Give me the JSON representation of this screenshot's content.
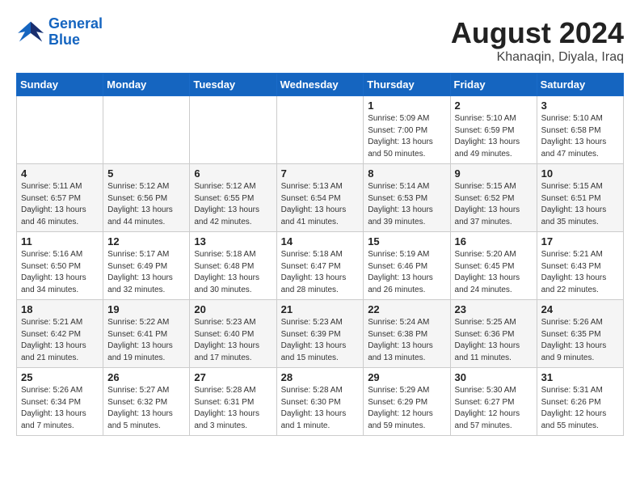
{
  "logo": {
    "line1": "General",
    "line2": "Blue"
  },
  "title": "August 2024",
  "subtitle": "Khanaqin, Diyala, Iraq",
  "headers": [
    "Sunday",
    "Monday",
    "Tuesday",
    "Wednesday",
    "Thursday",
    "Friday",
    "Saturday"
  ],
  "weeks": [
    [
      {
        "day": "",
        "info": ""
      },
      {
        "day": "",
        "info": ""
      },
      {
        "day": "",
        "info": ""
      },
      {
        "day": "",
        "info": ""
      },
      {
        "day": "1",
        "info": "Sunrise: 5:09 AM\nSunset: 7:00 PM\nDaylight: 13 hours\nand 50 minutes."
      },
      {
        "day": "2",
        "info": "Sunrise: 5:10 AM\nSunset: 6:59 PM\nDaylight: 13 hours\nand 49 minutes."
      },
      {
        "day": "3",
        "info": "Sunrise: 5:10 AM\nSunset: 6:58 PM\nDaylight: 13 hours\nand 47 minutes."
      }
    ],
    [
      {
        "day": "4",
        "info": "Sunrise: 5:11 AM\nSunset: 6:57 PM\nDaylight: 13 hours\nand 46 minutes."
      },
      {
        "day": "5",
        "info": "Sunrise: 5:12 AM\nSunset: 6:56 PM\nDaylight: 13 hours\nand 44 minutes."
      },
      {
        "day": "6",
        "info": "Sunrise: 5:12 AM\nSunset: 6:55 PM\nDaylight: 13 hours\nand 42 minutes."
      },
      {
        "day": "7",
        "info": "Sunrise: 5:13 AM\nSunset: 6:54 PM\nDaylight: 13 hours\nand 41 minutes."
      },
      {
        "day": "8",
        "info": "Sunrise: 5:14 AM\nSunset: 6:53 PM\nDaylight: 13 hours\nand 39 minutes."
      },
      {
        "day": "9",
        "info": "Sunrise: 5:15 AM\nSunset: 6:52 PM\nDaylight: 13 hours\nand 37 minutes."
      },
      {
        "day": "10",
        "info": "Sunrise: 5:15 AM\nSunset: 6:51 PM\nDaylight: 13 hours\nand 35 minutes."
      }
    ],
    [
      {
        "day": "11",
        "info": "Sunrise: 5:16 AM\nSunset: 6:50 PM\nDaylight: 13 hours\nand 34 minutes."
      },
      {
        "day": "12",
        "info": "Sunrise: 5:17 AM\nSunset: 6:49 PM\nDaylight: 13 hours\nand 32 minutes."
      },
      {
        "day": "13",
        "info": "Sunrise: 5:18 AM\nSunset: 6:48 PM\nDaylight: 13 hours\nand 30 minutes."
      },
      {
        "day": "14",
        "info": "Sunrise: 5:18 AM\nSunset: 6:47 PM\nDaylight: 13 hours\nand 28 minutes."
      },
      {
        "day": "15",
        "info": "Sunrise: 5:19 AM\nSunset: 6:46 PM\nDaylight: 13 hours\nand 26 minutes."
      },
      {
        "day": "16",
        "info": "Sunrise: 5:20 AM\nSunset: 6:45 PM\nDaylight: 13 hours\nand 24 minutes."
      },
      {
        "day": "17",
        "info": "Sunrise: 5:21 AM\nSunset: 6:43 PM\nDaylight: 13 hours\nand 22 minutes."
      }
    ],
    [
      {
        "day": "18",
        "info": "Sunrise: 5:21 AM\nSunset: 6:42 PM\nDaylight: 13 hours\nand 21 minutes."
      },
      {
        "day": "19",
        "info": "Sunrise: 5:22 AM\nSunset: 6:41 PM\nDaylight: 13 hours\nand 19 minutes."
      },
      {
        "day": "20",
        "info": "Sunrise: 5:23 AM\nSunset: 6:40 PM\nDaylight: 13 hours\nand 17 minutes."
      },
      {
        "day": "21",
        "info": "Sunrise: 5:23 AM\nSunset: 6:39 PM\nDaylight: 13 hours\nand 15 minutes."
      },
      {
        "day": "22",
        "info": "Sunrise: 5:24 AM\nSunset: 6:38 PM\nDaylight: 13 hours\nand 13 minutes."
      },
      {
        "day": "23",
        "info": "Sunrise: 5:25 AM\nSunset: 6:36 PM\nDaylight: 13 hours\nand 11 minutes."
      },
      {
        "day": "24",
        "info": "Sunrise: 5:26 AM\nSunset: 6:35 PM\nDaylight: 13 hours\nand 9 minutes."
      }
    ],
    [
      {
        "day": "25",
        "info": "Sunrise: 5:26 AM\nSunset: 6:34 PM\nDaylight: 13 hours\nand 7 minutes."
      },
      {
        "day": "26",
        "info": "Sunrise: 5:27 AM\nSunset: 6:32 PM\nDaylight: 13 hours\nand 5 minutes."
      },
      {
        "day": "27",
        "info": "Sunrise: 5:28 AM\nSunset: 6:31 PM\nDaylight: 13 hours\nand 3 minutes."
      },
      {
        "day": "28",
        "info": "Sunrise: 5:28 AM\nSunset: 6:30 PM\nDaylight: 13 hours\nand 1 minute."
      },
      {
        "day": "29",
        "info": "Sunrise: 5:29 AM\nSunset: 6:29 PM\nDaylight: 12 hours\nand 59 minutes."
      },
      {
        "day": "30",
        "info": "Sunrise: 5:30 AM\nSunset: 6:27 PM\nDaylight: 12 hours\nand 57 minutes."
      },
      {
        "day": "31",
        "info": "Sunrise: 5:31 AM\nSunset: 6:26 PM\nDaylight: 12 hours\nand 55 minutes."
      }
    ]
  ]
}
